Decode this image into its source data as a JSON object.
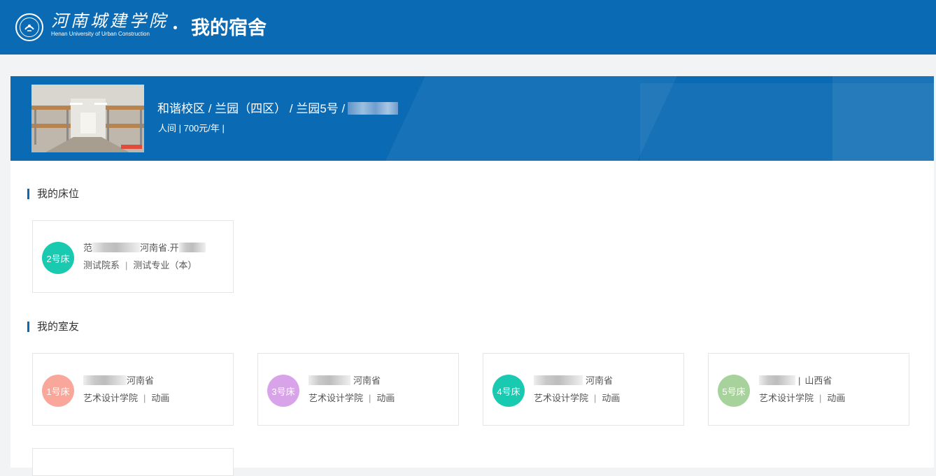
{
  "header": {
    "logo_cn": "河南城建学院",
    "logo_en": "Henan University of Urban Construction",
    "page_title": "我的宿舍"
  },
  "room": {
    "path": "和谐校区 / 兰园（四区） / 兰园5号 /",
    "meta": "人间 | 700元/年 |"
  },
  "my_bed": {
    "section_title": "我的床位",
    "bed": {
      "badge": "2号床",
      "name_prefix": "范",
      "origin": "河南省.开",
      "college": "测试院系",
      "major": "测试专业（本）",
      "color": "#19c9b0"
    }
  },
  "roommates": {
    "section_title": "我的室友",
    "items": [
      {
        "badge": "1号床",
        "origin": "河南省",
        "college": "艺术设计学院",
        "major": "动画",
        "color": "#f9a79a"
      },
      {
        "badge": "3号床",
        "origin": "河南省",
        "college": "艺术设计学院",
        "major": "动画",
        "color": "#d9a3ea"
      },
      {
        "badge": "4号床",
        "origin": "河南省",
        "college": "艺术设计学院",
        "major": "动画",
        "color": "#19c9b0"
      },
      {
        "badge": "5号床",
        "origin": "山西省",
        "college": "艺术设计学院",
        "major": "动画",
        "color": "#a7d29b"
      }
    ]
  },
  "icons": {
    "logo": "university-seal-icon"
  }
}
